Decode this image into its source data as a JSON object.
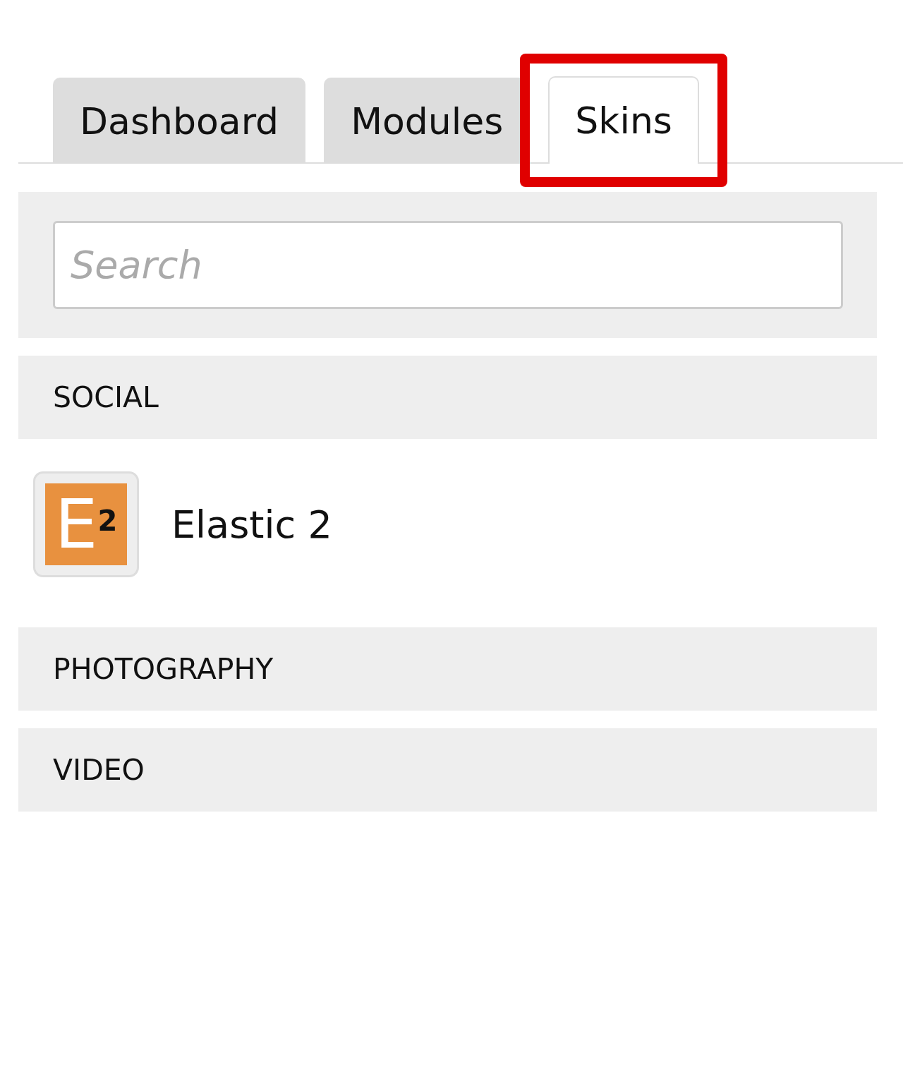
{
  "tabs": [
    {
      "label": "Dashboard",
      "selected": false,
      "highlighted": false
    },
    {
      "label": "Modules",
      "selected": false,
      "highlighted": false
    },
    {
      "label": "Skins",
      "selected": true,
      "highlighted": true
    }
  ],
  "search": {
    "placeholder": "Search"
  },
  "categories": [
    {
      "name": "SOCIAL",
      "items": [
        {
          "name": "Elastic 2",
          "logo": {
            "letter": "E",
            "mark": "2",
            "color": "#e8913f"
          }
        }
      ]
    },
    {
      "name": "PHOTOGRAPHY"
    },
    {
      "name": "VIDEO"
    }
  ]
}
